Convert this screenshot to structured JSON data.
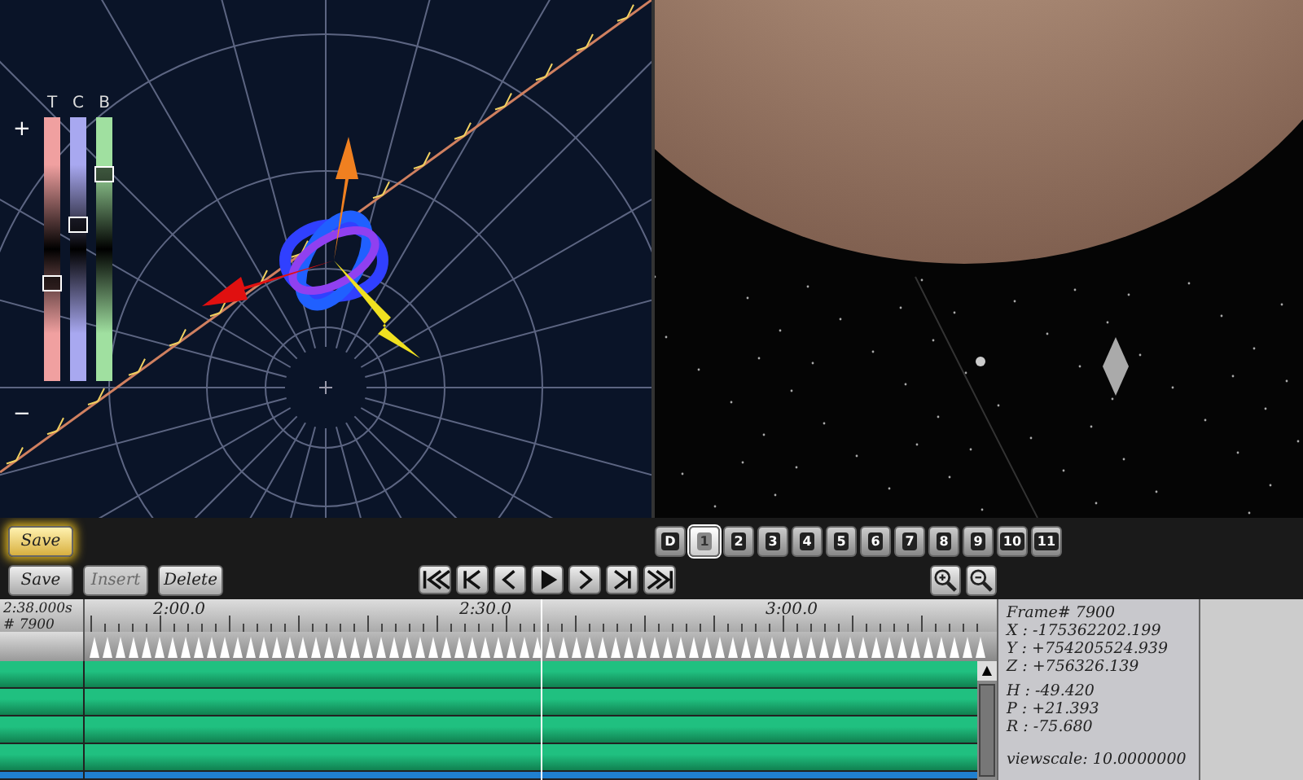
{
  "scene_view": {
    "sliders": [
      {
        "label": "T",
        "level": 0.36,
        "color": "#f0a0a0"
      },
      {
        "label": "C",
        "level": 0.6,
        "color": "#a8a8f0"
      },
      {
        "label": "B",
        "level": 0.8,
        "color": "#a0e0a0"
      }
    ],
    "plus_label": "+",
    "minus_label": "−"
  },
  "toolbar": {
    "glow_button": {
      "label": "Save"
    },
    "camera_buttons": [
      {
        "label": "D",
        "selected": false
      },
      {
        "label": "1",
        "selected": true
      },
      {
        "label": "2",
        "selected": false
      },
      {
        "label": "3",
        "selected": false
      },
      {
        "label": "4",
        "selected": false
      },
      {
        "label": "5",
        "selected": false
      },
      {
        "label": "6",
        "selected": false
      },
      {
        "label": "7",
        "selected": false
      },
      {
        "label": "8",
        "selected": false
      },
      {
        "label": "9",
        "selected": false
      },
      {
        "label": "10",
        "selected": false
      },
      {
        "label": "11",
        "selected": false
      }
    ],
    "edit_buttons": [
      {
        "label": "Save",
        "disabled": false
      },
      {
        "label": "Insert",
        "disabled": true
      },
      {
        "label": "Delete",
        "disabled": false
      }
    ],
    "transport": [
      {
        "kind": "first"
      },
      {
        "kind": "prev-key"
      },
      {
        "kind": "prev"
      },
      {
        "kind": "play"
      },
      {
        "kind": "next"
      },
      {
        "kind": "next-key"
      },
      {
        "kind": "last"
      }
    ],
    "zoom": [
      {
        "kind": "zoom-in"
      },
      {
        "kind": "zoom-out"
      }
    ]
  },
  "timeline": {
    "current_time": "2:38.000s",
    "current_frame": "# 7900",
    "ruler_labels": [
      {
        "label": "2:00.0"
      },
      {
        "label": "2:30.0"
      },
      {
        "label": "3:00.0"
      }
    ],
    "tracks": [
      {
        "color": "#20c080"
      },
      {
        "color": "#20c080"
      },
      {
        "color": "#20c080"
      },
      {
        "color": "#20c080"
      },
      {
        "color": "#2080d0"
      }
    ],
    "scroll_up": "▲"
  },
  "info": {
    "frame": "Frame# 7900",
    "lines": [
      {
        "text": "X : -175362202.199"
      },
      {
        "text": "Y : +754205524.939"
      },
      {
        "text": "Z : +756326.139"
      },
      {
        "text": "H : -49.420",
        "gap": true
      },
      {
        "text": "P : +21.393"
      },
      {
        "text": "R : -75.680"
      }
    ],
    "viewscale": "viewscale: 10.0000000"
  }
}
